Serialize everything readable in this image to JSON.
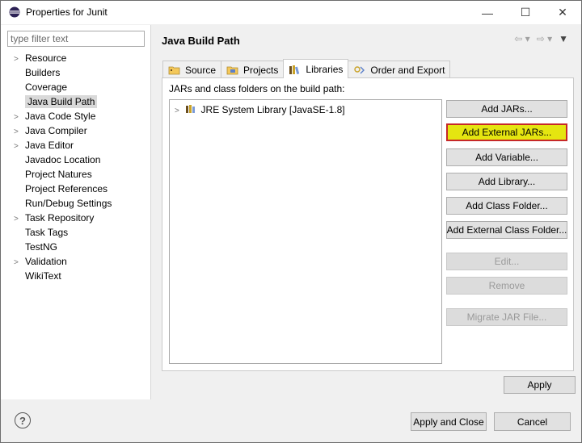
{
  "window": {
    "title": "Properties for Junit",
    "minimize": "—",
    "maximize": "☐",
    "close": "✕"
  },
  "filter": {
    "placeholder": "type filter text",
    "value": ""
  },
  "tree": [
    {
      "label": "Resource",
      "expandable": true
    },
    {
      "label": "Builders",
      "expandable": false
    },
    {
      "label": "Coverage",
      "expandable": false
    },
    {
      "label": "Java Build Path",
      "expandable": false,
      "selected": true
    },
    {
      "label": "Java Code Style",
      "expandable": true
    },
    {
      "label": "Java Compiler",
      "expandable": true
    },
    {
      "label": "Java Editor",
      "expandable": true
    },
    {
      "label": "Javadoc Location",
      "expandable": false
    },
    {
      "label": "Project Natures",
      "expandable": false
    },
    {
      "label": "Project References",
      "expandable": false
    },
    {
      "label": "Run/Debug Settings",
      "expandable": false
    },
    {
      "label": "Task Repository",
      "expandable": true
    },
    {
      "label": "Task Tags",
      "expandable": false
    },
    {
      "label": "TestNG",
      "expandable": false
    },
    {
      "label": "Validation",
      "expandable": true
    },
    {
      "label": "WikiText",
      "expandable": false
    }
  ],
  "page": {
    "title": "Java Build Path",
    "tabs": [
      {
        "label": "Source",
        "icon": "source-folder-icon"
      },
      {
        "label": "Projects",
        "icon": "projects-folder-icon"
      },
      {
        "label": "Libraries",
        "icon": "libraries-icon",
        "active": true
      },
      {
        "label": "Order and Export",
        "icon": "order-export-icon"
      }
    ],
    "panel_label": "JARs and class folders on the build path:",
    "libraries": [
      "JRE System Library [JavaSE-1.8]"
    ],
    "buttons": {
      "add_jars": "Add JARs...",
      "add_external_jars": "Add External JARs...",
      "add_variable": "Add Variable...",
      "add_library": "Add Library...",
      "add_class_folder": "Add Class Folder...",
      "add_external_class_folder": "Add External Class Folder...",
      "edit": "Edit...",
      "remove": "Remove",
      "migrate_jar": "Migrate JAR File..."
    },
    "apply": "Apply"
  },
  "footer": {
    "help": "?",
    "apply_and_close": "Apply and Close",
    "cancel": "Cancel"
  },
  "colors": {
    "highlight_fill": "#e5e510",
    "highlight_border": "#c62828",
    "selected_tree": "#d9d9d9"
  }
}
